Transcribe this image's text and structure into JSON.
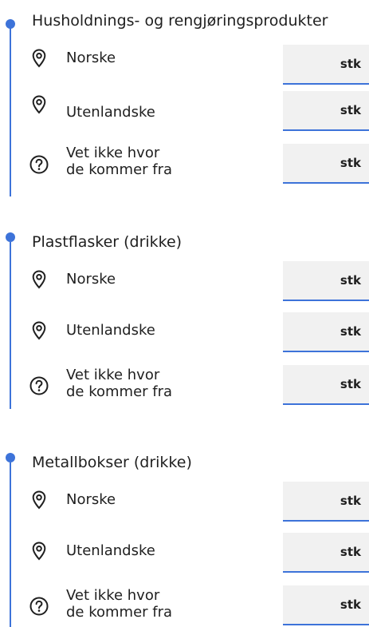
{
  "sections": [
    {
      "title": "Husholdnings- og rengjøringsprodukter",
      "rows": [
        {
          "label": "Norske",
          "icon": "location-pin-icon",
          "unit": "stk",
          "value": ""
        },
        {
          "label": "Utenlandske",
          "icon": "location-pin-icon",
          "unit": "stk",
          "value": ""
        },
        {
          "label_line1": "Vet ikke hvor",
          "label_line2": "de kommer fra",
          "icon": "question-icon",
          "unit": "stk",
          "value": ""
        }
      ]
    },
    {
      "title": "Plastflasker (drikke)",
      "rows": [
        {
          "label": "Norske",
          "icon": "location-pin-icon",
          "unit": "stk",
          "value": ""
        },
        {
          "label": "Utenlandske",
          "icon": "location-pin-icon",
          "unit": "stk",
          "value": ""
        },
        {
          "label_line1": "Vet ikke hvor",
          "label_line2": "de kommer fra",
          "icon": "question-icon",
          "unit": "stk",
          "value": ""
        }
      ]
    },
    {
      "title": "Metallbokser (drikke)",
      "rows": [
        {
          "label": "Norske",
          "icon": "location-pin-icon",
          "unit": "stk",
          "value": ""
        },
        {
          "label": "Utenlandske",
          "icon": "location-pin-icon",
          "unit": "stk",
          "value": ""
        },
        {
          "label_line1": "Vet ikke hvor",
          "label_line2": "de kommer fra",
          "icon": "question-icon",
          "unit": "stk",
          "value": ""
        }
      ]
    }
  ],
  "colors": {
    "accent": "#3d73d9",
    "field_background": "#f1f1f1",
    "text": "#1f1f1f"
  }
}
